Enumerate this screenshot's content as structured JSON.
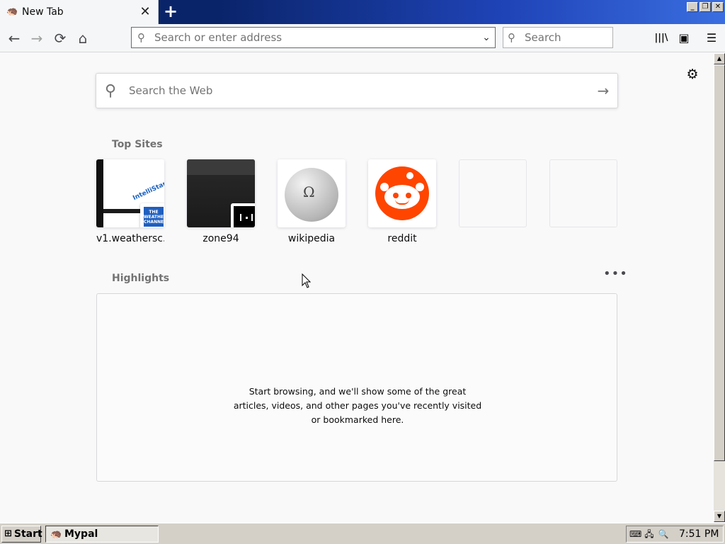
{
  "tab": {
    "title": "New Tab",
    "close_glyph": "✕",
    "favicon": "mypal-icon"
  },
  "toolbar": {
    "new_tab_glyph": "+",
    "back_glyph": "←",
    "forward_glyph": "→",
    "reload_glyph": "⟳",
    "home_glyph": "⌂",
    "url_placeholder": "Search or enter address",
    "url_dropdown_glyph": "⌄",
    "search_placeholder": "Search",
    "library_glyph": "|||\\",
    "sidebar_glyph": "▣",
    "menu_glyph": "☰"
  },
  "window_controls": {
    "minimize": "_",
    "restore": "❐",
    "close": "✕"
  },
  "newtab": {
    "settings_glyph": "⚙",
    "web_search_placeholder": "Search the Web",
    "go_glyph": "→",
    "top_sites_title": "Top Sites",
    "top_sites": [
      {
        "label": "v1.weathersc...",
        "thumb": "weather",
        "brand": "IntelliStar",
        "badge": "THE WEATHER CHANNEL"
      },
      {
        "label": "zone94",
        "thumb": "zone94"
      },
      {
        "label": "wikipedia",
        "thumb": "wikipedia"
      },
      {
        "label": "reddit",
        "thumb": "reddit"
      },
      {
        "label": "",
        "thumb": "empty"
      },
      {
        "label": "",
        "thumb": "empty"
      }
    ],
    "highlights_title": "Highlights",
    "more_glyph": "•••",
    "highlights_empty_message": "Start browsing, and we'll show some of the great articles, videos, and other pages you've recently visited or bookmarked here."
  },
  "taskbar": {
    "start_label": "Start",
    "task_label": "Mypal",
    "clock": "7:51 PM"
  },
  "colors": {
    "reddit": "#ff4500",
    "titlebar": "#0a246a",
    "taskbar": "#d4d0c8"
  }
}
